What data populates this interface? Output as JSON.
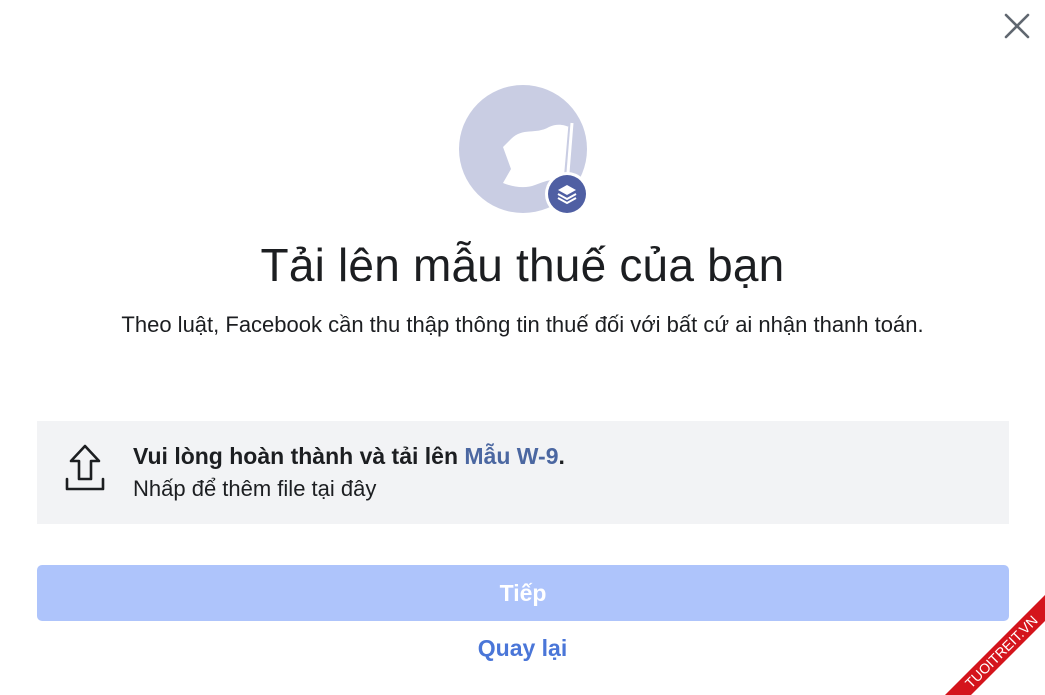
{
  "dialog": {
    "close_icon": "close-icon",
    "hero_icon": "flag-icon",
    "badge_icon": "stack-layers-icon",
    "title": "Tải lên mẫu thuế của bạn",
    "subtitle": "Theo luật, Facebook cần thu thập thông tin thuế đối với bất cứ ai nhận thanh toán."
  },
  "upload": {
    "icon": "upload-icon",
    "prompt_prefix": "Vui lòng hoàn thành và tải lên ",
    "form_link": "Mẫu W-9",
    "prompt_suffix": ".",
    "hint": "Nhấp để thêm file tại đây"
  },
  "actions": {
    "next_label": "Tiếp",
    "next_enabled": false,
    "back_label": "Quay lại"
  },
  "watermark": {
    "text": "TUOITREIT.VN"
  },
  "colors": {
    "hero_circle": "#c9cde3",
    "badge": "#4f5fa3",
    "upload_box_bg": "#f2f3f5",
    "link": "#4b67a1",
    "next_button_disabled": "#aec4fb",
    "back_link": "#4a76d8",
    "watermark_red": "#d4141c"
  }
}
